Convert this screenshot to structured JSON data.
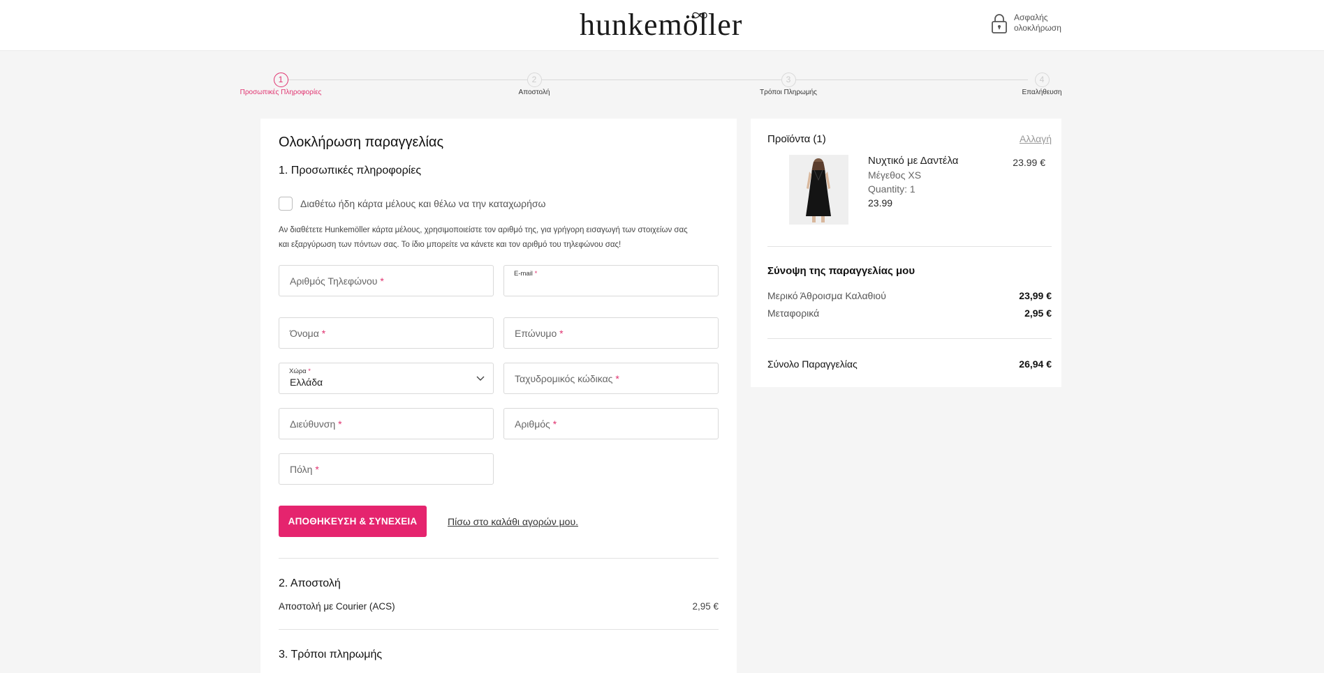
{
  "header": {
    "logo": "hunkemöller",
    "secure_label_1": "Ασφαλής",
    "secure_label_2": "ολοκλήρωση"
  },
  "steps": [
    {
      "number": "1",
      "label": "Προσωπικές Πληροφορίες",
      "active": true
    },
    {
      "number": "2",
      "label": "Αποστολή",
      "active": false
    },
    {
      "number": "3",
      "label": "Τρόποι Πληρωμής",
      "active": false
    },
    {
      "number": "4",
      "label": "Επαλήθευση",
      "active": false
    }
  ],
  "checkout": {
    "title": "Ολοκλήρωση παραγγελίας",
    "section1_title": "1. Προσωπικές πληροφορίες",
    "member_card_label": "Διαθέτω ήδη κάρτα μέλους και θέλω να την καταχωρήσω",
    "member_info_line1": "Αν διαθέτετε Hunkemöller κάρτα μέλους, χρησιμοποιείστε τον αριθμό της, για γρήγορη εισαγωγή των στοιχείων σας",
    "member_info_line2": "και εξαργύρωση των πόντων σας. Το ίδιο μπορείτε να κάνετε και τον αριθμό του τηλεφώνου σας!",
    "fields": {
      "phone_placeholder": "Αριθμός Τηλεφώνου",
      "email_label": "E-mail",
      "first_name_placeholder": "Όνομα",
      "last_name_placeholder": "Επώνυμο",
      "country_label": "Χώρα",
      "country_value": "Ελλάδα",
      "postal_code_placeholder": "Ταχυδρομικός κώδικας",
      "address_placeholder": "Διεύθυνση",
      "house_number_placeholder": "Αριθμός",
      "city_placeholder": "Πόλη",
      "required_mark": "*"
    },
    "save_button": "ΑΠΟΘΗΚΕΥΣΗ & ΣΥΝΕΧΕΙΑ",
    "back_link": "Πίσω στο καλάθι αγορών μου.",
    "section2_title": "2. Αποστολή",
    "shipping_method": "Αποστολή με Courier (ACS)",
    "shipping_price": "2,95 €",
    "section3_title": "3. Τρόποι πληρωμής"
  },
  "cart": {
    "heading": "Προϊόντα (1)",
    "change_link": "Αλλαγή",
    "product": {
      "name": "Νυχτικό με Δαντέλα",
      "size": "Μέγεθος XS",
      "quantity": "Quantity: 1",
      "unit_price": "23.99",
      "price": "23.99 €"
    },
    "summary_title": "Σύνοψη της παραγγελίας μου",
    "subtotal_label": "Μερικό Άθροισμα Καλαθιού",
    "subtotal_value": "23,99 €",
    "shipping_label": "Μεταφορικά",
    "shipping_value": "2,95 €",
    "total_label": "Σύνολο Παραγγελίας",
    "total_value": "26,94 €"
  },
  "colors": {
    "accent": "#e5246e",
    "background": "#f5f5f5"
  }
}
